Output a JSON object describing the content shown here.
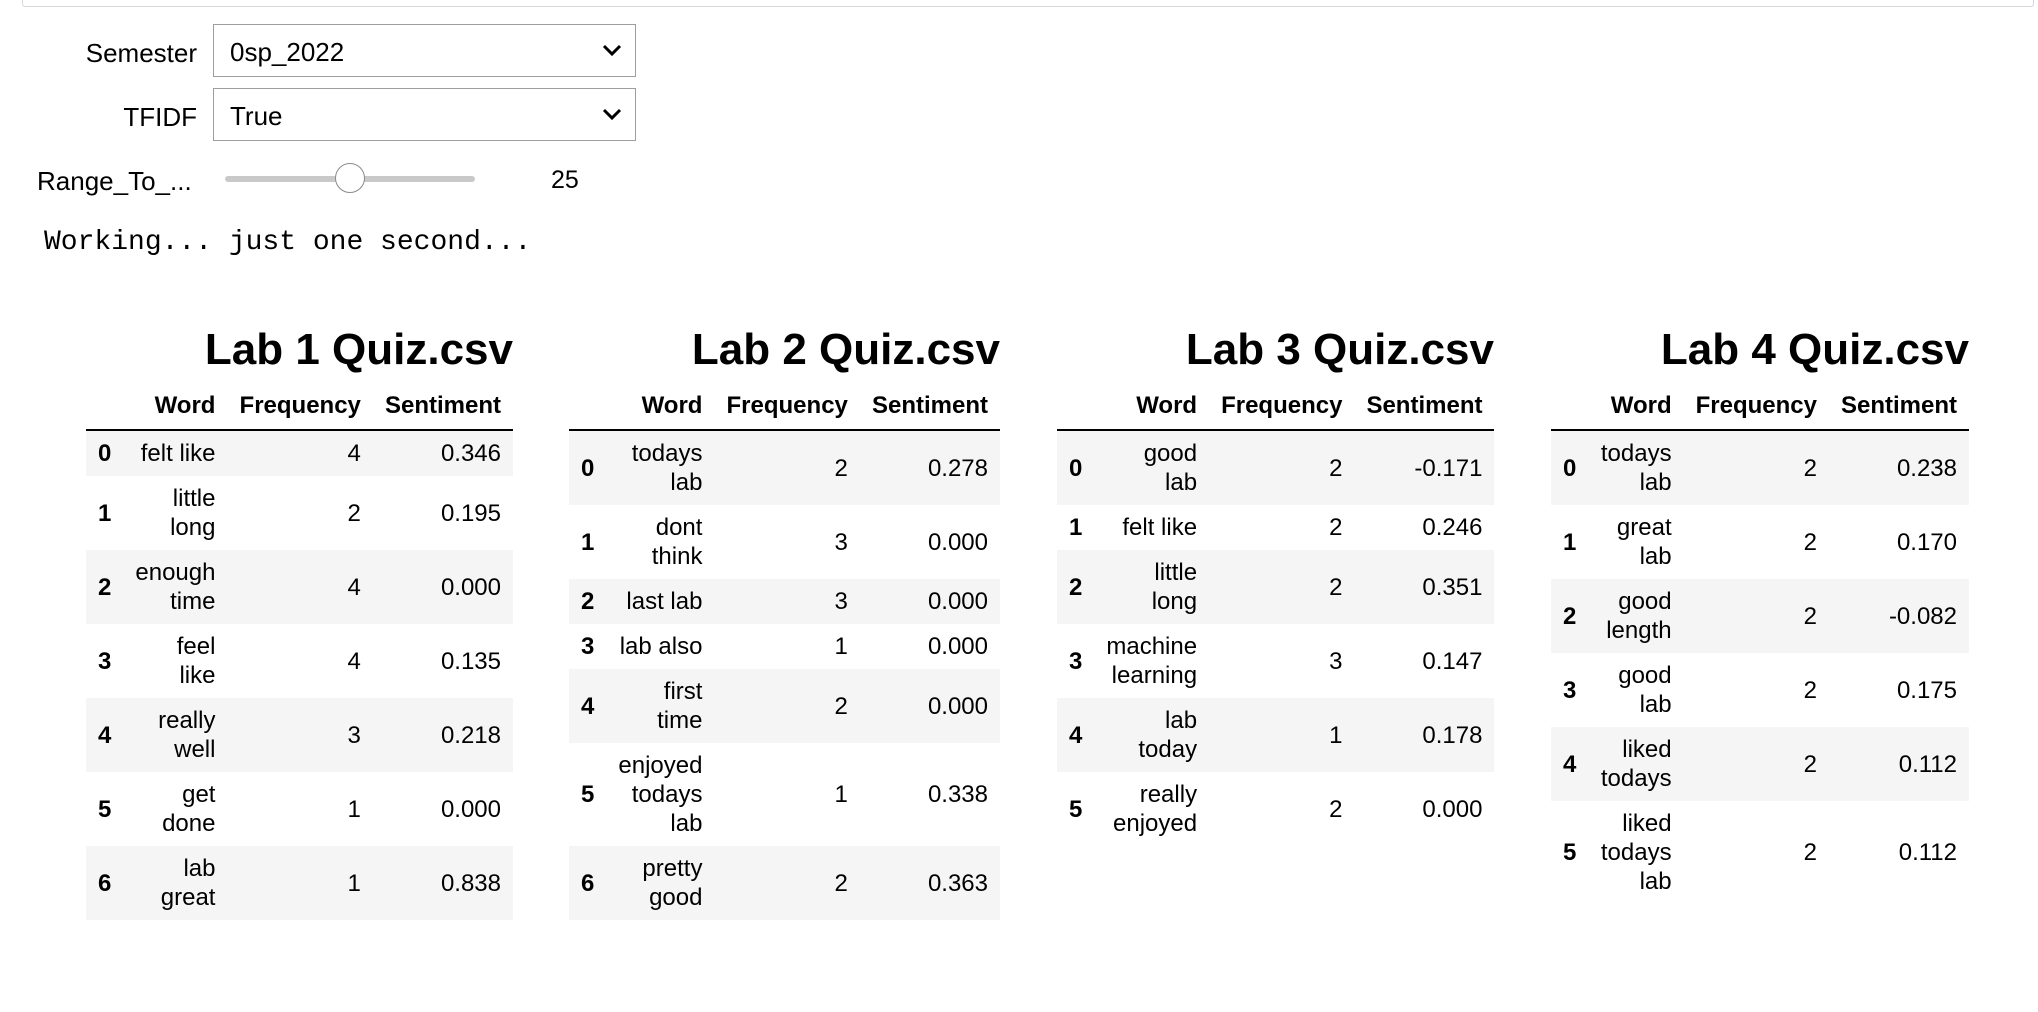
{
  "widgets": {
    "semester_label": "Semester",
    "semester_value": "0sp_2022",
    "tfidf_label": "TFIDF",
    "tfidf_value": "True",
    "range_label": "Range_To_...",
    "range_value": "25",
    "range_fraction": 0.5
  },
  "status": "Working... just one second...",
  "tables": [
    {
      "title": "Lab 1 Quiz.csv",
      "headers": [
        "",
        "Word",
        "Frequency",
        "Sentiment"
      ],
      "rows": [
        {
          "idx": "0",
          "word": "felt like",
          "freq": "4",
          "sent": "0.346"
        },
        {
          "idx": "1",
          "word": "little long",
          "freq": "2",
          "sent": "0.195"
        },
        {
          "idx": "2",
          "word": "enough time",
          "freq": "4",
          "sent": "0.000"
        },
        {
          "idx": "3",
          "word": "feel like",
          "freq": "4",
          "sent": "0.135"
        },
        {
          "idx": "4",
          "word": "really well",
          "freq": "3",
          "sent": "0.218"
        },
        {
          "idx": "5",
          "word": "get done",
          "freq": "1",
          "sent": "0.000"
        },
        {
          "idx": "6",
          "word": "lab great",
          "freq": "1",
          "sent": "0.838"
        }
      ]
    },
    {
      "title": "Lab 2 Quiz.csv",
      "headers": [
        "",
        "Word",
        "Frequency",
        "Sentiment"
      ],
      "rows": [
        {
          "idx": "0",
          "word": "todays lab",
          "freq": "2",
          "sent": "0.278"
        },
        {
          "idx": "1",
          "word": "dont think",
          "freq": "3",
          "sent": "0.000"
        },
        {
          "idx": "2",
          "word": "last lab",
          "freq": "3",
          "sent": "0.000"
        },
        {
          "idx": "3",
          "word": "lab also",
          "freq": "1",
          "sent": "0.000"
        },
        {
          "idx": "4",
          "word": "first time",
          "freq": "2",
          "sent": "0.000"
        },
        {
          "idx": "5",
          "word": "enjoyed todays lab",
          "freq": "1",
          "sent": "0.338"
        },
        {
          "idx": "6",
          "word": "pretty good",
          "freq": "2",
          "sent": "0.363"
        }
      ]
    },
    {
      "title": "Lab 3 Quiz.csv",
      "headers": [
        "",
        "Word",
        "Frequency",
        "Sentiment"
      ],
      "rows": [
        {
          "idx": "0",
          "word": "good lab",
          "freq": "2",
          "sent": "-0.171"
        },
        {
          "idx": "1",
          "word": "felt like",
          "freq": "2",
          "sent": "0.246"
        },
        {
          "idx": "2",
          "word": "little long",
          "freq": "2",
          "sent": "0.351"
        },
        {
          "idx": "3",
          "word": "machine learning",
          "freq": "3",
          "sent": "0.147"
        },
        {
          "idx": "4",
          "word": "lab today",
          "freq": "1",
          "sent": "0.178"
        },
        {
          "idx": "5",
          "word": "really enjoyed",
          "freq": "2",
          "sent": "0.000"
        }
      ]
    },
    {
      "title": "Lab 4 Quiz.csv",
      "headers": [
        "",
        "Word",
        "Frequency",
        "Sentiment"
      ],
      "rows": [
        {
          "idx": "0",
          "word": "todays lab",
          "freq": "2",
          "sent": "0.238"
        },
        {
          "idx": "1",
          "word": "great lab",
          "freq": "2",
          "sent": "0.170"
        },
        {
          "idx": "2",
          "word": "good length",
          "freq": "2",
          "sent": "-0.082"
        },
        {
          "idx": "3",
          "word": "good lab",
          "freq": "2",
          "sent": "0.175"
        },
        {
          "idx": "4",
          "word": "liked todays",
          "freq": "2",
          "sent": "0.112"
        },
        {
          "idx": "5",
          "word": "liked todays lab",
          "freq": "2",
          "sent": "0.112"
        }
      ]
    }
  ]
}
